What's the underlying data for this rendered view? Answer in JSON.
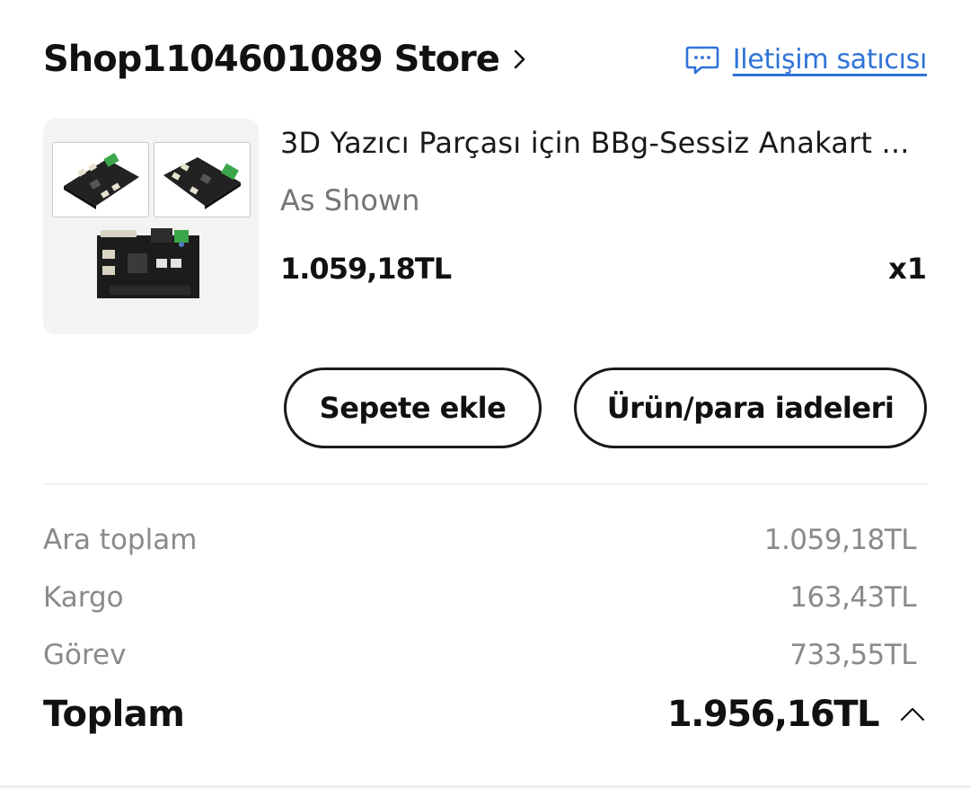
{
  "store": {
    "name": "Shop1104601089 Store",
    "contact_label": "Iletişim satıcısı",
    "chevron_icon": "chevron-right-icon",
    "contact_icon": "chat-bubble-icon"
  },
  "product": {
    "title": "3D Yazıcı Parçası için BBg-Sessiz Anakart ...",
    "variant": "As Shown",
    "price": "1.059,18TL",
    "quantity": "x1"
  },
  "actions": {
    "add_to_cart": "Sepete ekle",
    "returns": "Ürün/para iadeleri"
  },
  "summary": {
    "subtotal_label": "Ara toplam",
    "subtotal_value": "1.059,18TL",
    "shipping_label": "Kargo",
    "shipping_value": "163,43TL",
    "duty_label": "Görev",
    "duty_value": "733,55TL",
    "total_label": "Toplam",
    "total_value": "1.956,16TL",
    "toggle_icon": "chevron-up-icon"
  },
  "colors": {
    "link": "#2f73d8",
    "text": "#111111",
    "muted": "#8a8a8a",
    "variant": "#757575",
    "divider": "#e6e6e6"
  }
}
